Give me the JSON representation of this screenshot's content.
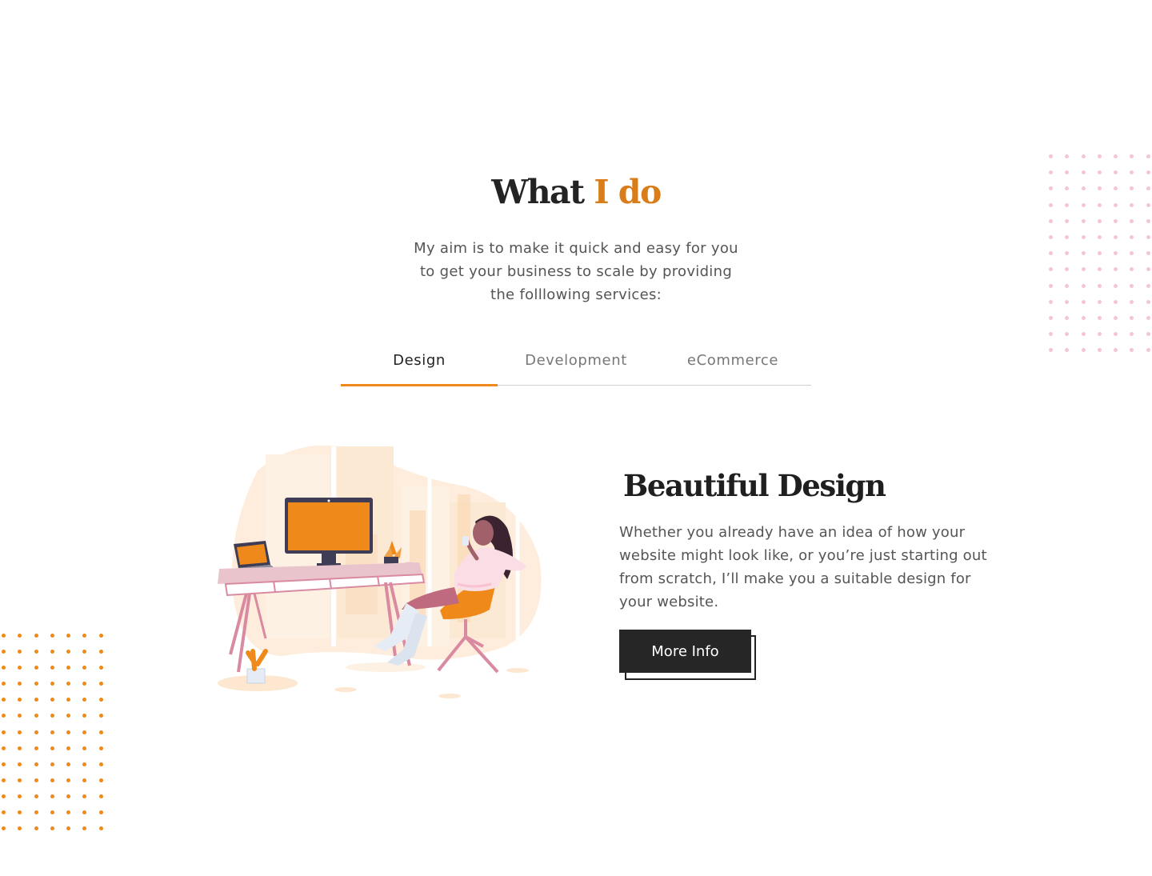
{
  "section": {
    "title_main": "What",
    "title_accent": "I do",
    "intro_line1": "My aim is to make it quick and easy for you",
    "intro_line2": "to get your business to scale by providing",
    "intro_line3": "the folllowing services:"
  },
  "tabs": [
    {
      "label": "Design",
      "active": true
    },
    {
      "label": "Development",
      "active": false
    },
    {
      "label": "eCommerce",
      "active": false
    }
  ],
  "content": {
    "title": "Beautiful Design",
    "text": "Whether you already have an idea of how your website might look like, or you’re just starting out from scratch, I’ll make you a suitable design for your website.",
    "button_label": "More Info"
  },
  "colors": {
    "accent": "#d97d1a",
    "tab_underline": "#ef8a1a",
    "dots_top_right": "#f4c6d3",
    "dots_bottom_left": "#ef8a1a",
    "button_bg": "#262626"
  },
  "icons": {
    "illustration": "woman-at-desk-illustration"
  }
}
